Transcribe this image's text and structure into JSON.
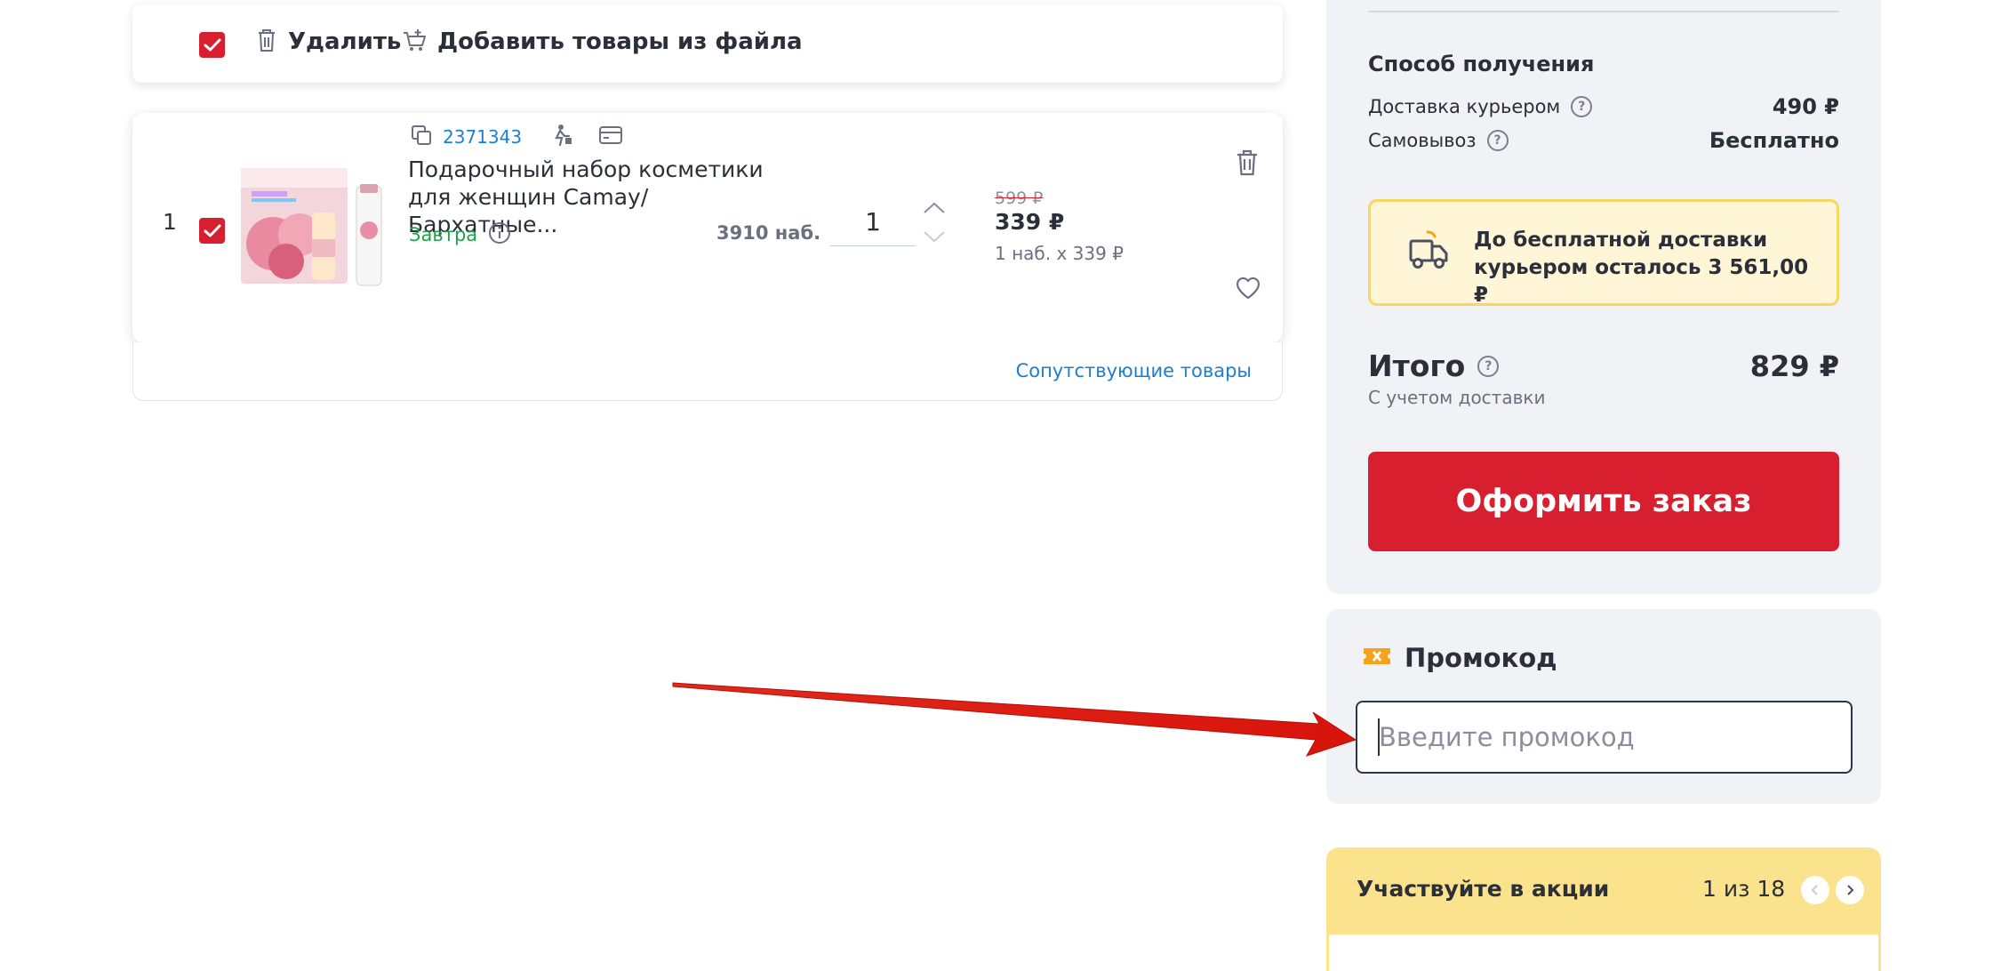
{
  "toolbar": {
    "delete_label": "Удалить",
    "add_from_file_label": "Добавить товары из файла"
  },
  "cart_item": {
    "index": "1",
    "sku": "2371343",
    "title": "Подарочный набор косметики для женщин Camay/Бархатные...",
    "delivery": "Завтра",
    "stock": "3910 наб.",
    "quantity": "1",
    "old_price": "599 ₽",
    "price": "339 ₽",
    "unit_price": "1 наб. x 339 ₽"
  },
  "related": {
    "link_label": "Сопутствующие товары"
  },
  "summary": {
    "delivery_method_title": "Способ получения",
    "courier_label": "Доставка курьером",
    "courier_price": "490 ₽",
    "pickup_label": "Самовывоз",
    "pickup_price": "Бесплатно",
    "free_delivery_note": "До бесплатной доставки курьером осталось 3 561,00 ₽",
    "total_label": "Итого",
    "total_sub": "С учетом доставки",
    "total_value": "829 ₽",
    "checkout_label": "Оформить заказ"
  },
  "promo": {
    "title": "Промокод",
    "placeholder": "Введите промокод",
    "value": ""
  },
  "actions": {
    "title": "Участвуйте в акции",
    "counter": "1 из 18"
  },
  "colors": {
    "accent_red": "#d71f30",
    "link_blue": "#1a7fd4",
    "delivery_green": "#1fa049",
    "promo_icon_orange": "#f7a21b",
    "notice_yellow": "#fff6d8",
    "actions_yellow": "#fbe28c"
  },
  "icons": {
    "toolbar": [
      "trash-icon",
      "cart-plus-icon"
    ],
    "item": [
      "copy-icon",
      "courier-icon",
      "card-icon",
      "info-icon",
      "chevron-up-icon",
      "chevron-down-icon",
      "trash-icon",
      "heart-icon"
    ],
    "summary": [
      "question-icon",
      "truck-icon"
    ],
    "promo": [
      "ticket-icon"
    ],
    "actions": [
      "chevron-left-icon",
      "chevron-right-icon"
    ]
  }
}
